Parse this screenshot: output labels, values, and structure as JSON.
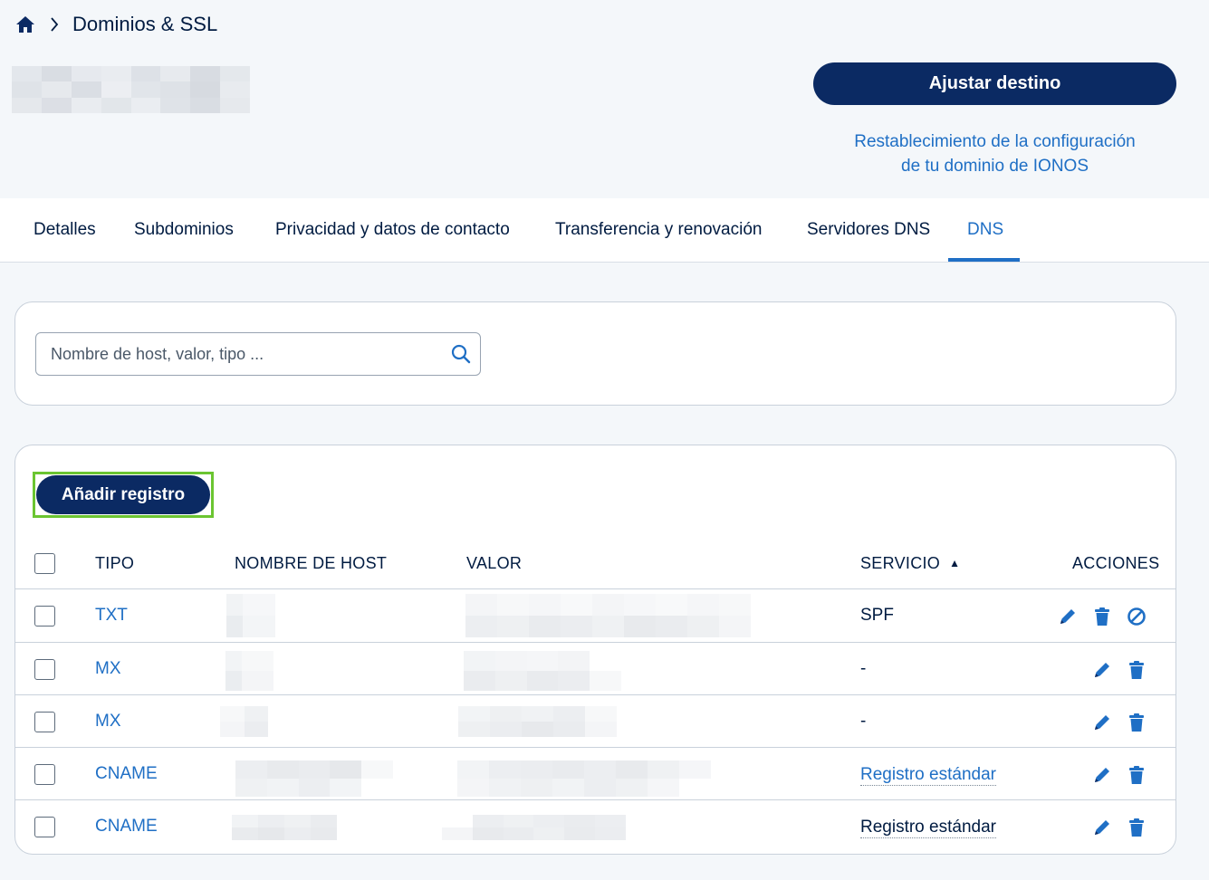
{
  "breadcrumb": {
    "current": "Dominios & SSL"
  },
  "header": {
    "adjust_button": "Ajustar destino",
    "reset_link_line1": "Restablecimiento de la configuración",
    "reset_link_line2": "de tu dominio de IONOS"
  },
  "tabs": [
    {
      "label": "Detalles"
    },
    {
      "label": "Subdominios"
    },
    {
      "label": "Privacidad y datos de contacto"
    },
    {
      "label": "Transferencia y renovación"
    },
    {
      "label": "Servidores DNS"
    },
    {
      "label": "DNS",
      "active": true
    }
  ],
  "search": {
    "placeholder": "Nombre de host, valor, tipo ..."
  },
  "table": {
    "add_button": "Añadir registro",
    "columns": {
      "type": "TIPO",
      "host": "NOMBRE DE HOST",
      "value": "VALOR",
      "service": "SERVICIO",
      "actions": "ACCIONES"
    },
    "sort_indicator": "▲",
    "rows": [
      {
        "type": "TXT",
        "service": "SPF",
        "actions": [
          "edit",
          "delete",
          "disable"
        ]
      },
      {
        "type": "MX",
        "service": "-",
        "actions": [
          "edit",
          "delete"
        ]
      },
      {
        "type": "MX",
        "service": "-",
        "actions": [
          "edit",
          "delete"
        ]
      },
      {
        "type": "CNAME",
        "service": "Registro estándar",
        "actions": [
          "edit",
          "delete"
        ]
      },
      {
        "type": "CNAME",
        "service": "Registro estándar",
        "actions": [
          "edit",
          "delete"
        ]
      }
    ]
  },
  "colors": {
    "brand": "#0b2a63",
    "link": "#1f6fc5",
    "highlight": "#6bc531"
  }
}
